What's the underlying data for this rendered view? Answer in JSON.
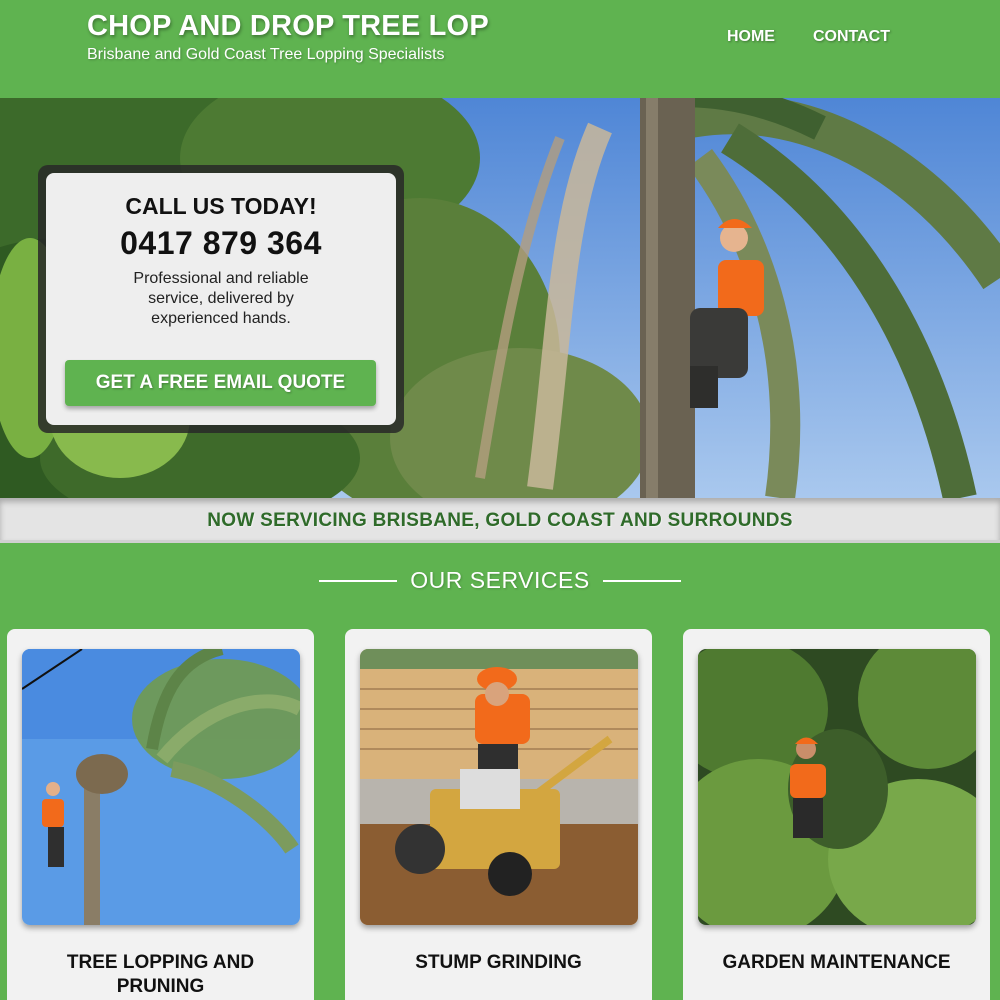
{
  "header": {
    "title": "CHOP AND DROP TREE LOP",
    "tagline": "Brisbane and Gold Coast Tree Lopping Specialists",
    "nav": [
      "HOME",
      "CONTACT"
    ]
  },
  "hero": {
    "cta_heading": "CALL US TODAY!",
    "phone": "0417 879 364",
    "description": "Professional and reliable service, delivered by experienced hands.",
    "button_label": "GET A FREE EMAIL QUOTE"
  },
  "banner": {
    "text": "NOW SERVICING BRISBANE, GOLD COAST AND SURROUNDS"
  },
  "services": {
    "heading": "OUR SERVICES",
    "items": [
      {
        "title": "TREE LOPPING AND PRUNING",
        "image": "palm-tree-climber-photo"
      },
      {
        "title": "STUMP GRINDING",
        "image": "stump-grinder-photo"
      },
      {
        "title": "GARDEN MAINTENANCE",
        "image": "garden-worker-photo"
      }
    ]
  },
  "colors": {
    "brand_green": "#5fb350",
    "banner_text": "#2f6b2a",
    "card_bg": "#f2f2f2",
    "safety_orange": "#f26a1b"
  }
}
